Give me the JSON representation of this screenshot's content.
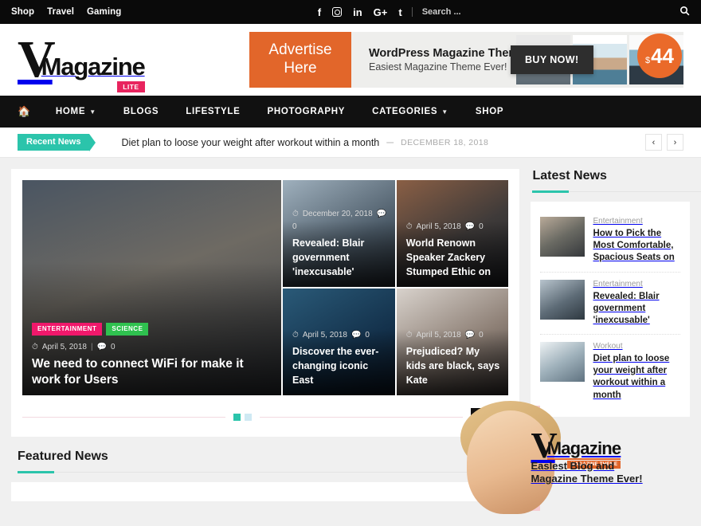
{
  "topbar": {
    "links": [
      {
        "label": "Shop"
      },
      {
        "label": "Travel"
      },
      {
        "label": "Gaming"
      }
    ],
    "social": [
      {
        "name": "facebook-icon",
        "glyph": "f"
      },
      {
        "name": "instagram-icon",
        "glyph": ""
      },
      {
        "name": "linkedin-icon",
        "glyph": "in"
      },
      {
        "name": "googleplus-icon",
        "glyph": "G+"
      },
      {
        "name": "tumblr-icon",
        "glyph": "t"
      }
    ],
    "search_placeholder": "Search ...",
    "search_value": "",
    "search_icon": "search-icon"
  },
  "logo": {
    "v": "V",
    "word": "Magazine",
    "badge": "LITE"
  },
  "ad": {
    "orange_line1": "Advertise",
    "orange_line2": "Here",
    "headline": "WordPress Magazine Theme",
    "subline": "Easiest  Magazine Theme Ever!",
    "buy_label": "BUY NOW!",
    "price_currency": "$",
    "price_amount": "44"
  },
  "nav": {
    "home_icon": "home-icon",
    "items": [
      {
        "label": "HOME",
        "has_caret": true
      },
      {
        "label": "BLOGS",
        "has_caret": false
      },
      {
        "label": "LIFESTYLE",
        "has_caret": false
      },
      {
        "label": "PHOTOGRAPHY",
        "has_caret": false
      },
      {
        "label": "CATEGORIES",
        "has_caret": true
      },
      {
        "label": "SHOP",
        "has_caret": false
      }
    ]
  },
  "ticker": {
    "badge": "Recent News",
    "headline": "Diet plan to loose your weight after workout within a month",
    "separator": "–",
    "date": "DECEMBER 18, 2018",
    "prev": "‹",
    "next": "›"
  },
  "hero": {
    "featured": {
      "categories": [
        {
          "label": "ENTERTAINMENT",
          "color": "#f0186b"
        },
        {
          "label": "SCIENCE",
          "color": "#2fc14f"
        }
      ],
      "date": "April 5, 2018",
      "comments": "0",
      "title": "We need to connect WiFi for make it work for Users"
    },
    "cells": [
      {
        "date": "December 20, 2018",
        "comments": "0",
        "title": "Revealed: Blair government 'inexcusable'"
      },
      {
        "date": "April 5, 2018",
        "comments": "0",
        "title": "World Renown Speaker Zackery Stumped Ethic on"
      },
      {
        "date": "April 5, 2018",
        "comments": "0",
        "title": "Discover the ever-changing iconic East"
      },
      {
        "date": "April 5, 2018",
        "comments": "0",
        "title": "Prejudiced? My kids are black, says Kate"
      }
    ],
    "dots": [
      {
        "active": true
      },
      {
        "active": false
      }
    ],
    "prev": "‹",
    "next": "›"
  },
  "featured_section": {
    "title": "Featured News",
    "cards": [
      {
        "name": "featured-card-1"
      },
      {
        "name": "featured-card-2"
      },
      {
        "name": "featured-card-3"
      },
      {
        "name": "featured-card-4"
      }
    ]
  },
  "sidebar": {
    "latest_title": "Latest News",
    "items": [
      {
        "category": "Entertainment",
        "title": "How to Pick the Most Comfortable, Spacious Seats on"
      },
      {
        "category": "Entertainment",
        "title": "Revealed: Blair government 'inexcusable'"
      },
      {
        "category": "Workout",
        "title": "Diet plan to loose your weight after workout within a month"
      }
    ],
    "promo": {
      "v": "V",
      "word": "Magazine",
      "badge": "MAGAZINE THEME",
      "line1": "Easlest Blog and",
      "line2": "Magazine Theme Ever!"
    }
  },
  "colors": {
    "accent_teal": "#2bc4ab",
    "accent_pink": "#e8245e",
    "badge_pink": "#f0186b",
    "badge_green": "#2fc14f",
    "ad_orange": "#e2662a",
    "price_orange": "#ea6a2a",
    "promo_pink": "#f6cdd2",
    "dark": "#111111"
  }
}
